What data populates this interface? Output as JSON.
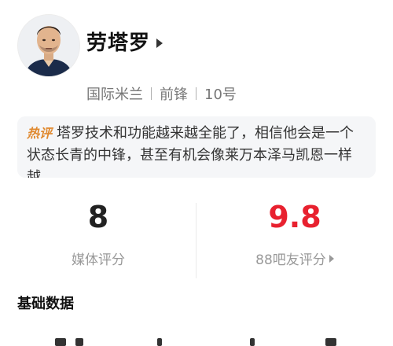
{
  "player": {
    "name": "劳塔罗",
    "avatar_icon": "player-avatar-icon",
    "team": "国际米兰",
    "position": "前锋",
    "number": "10号"
  },
  "hot_comment": {
    "tag": "热评",
    "text": "塔罗技术和功能越来越全能了，相信他会是一个状态长青的中锋，甚至有机会像莱万本泽马凯恩一样越..."
  },
  "ratings": {
    "media": {
      "value": "8",
      "label": "媒体评分"
    },
    "fans": {
      "value": "9.8",
      "label": "88吧友评分",
      "accent_color": "#e8212f"
    }
  },
  "sections": {
    "basic_data_title": "基础数据"
  }
}
